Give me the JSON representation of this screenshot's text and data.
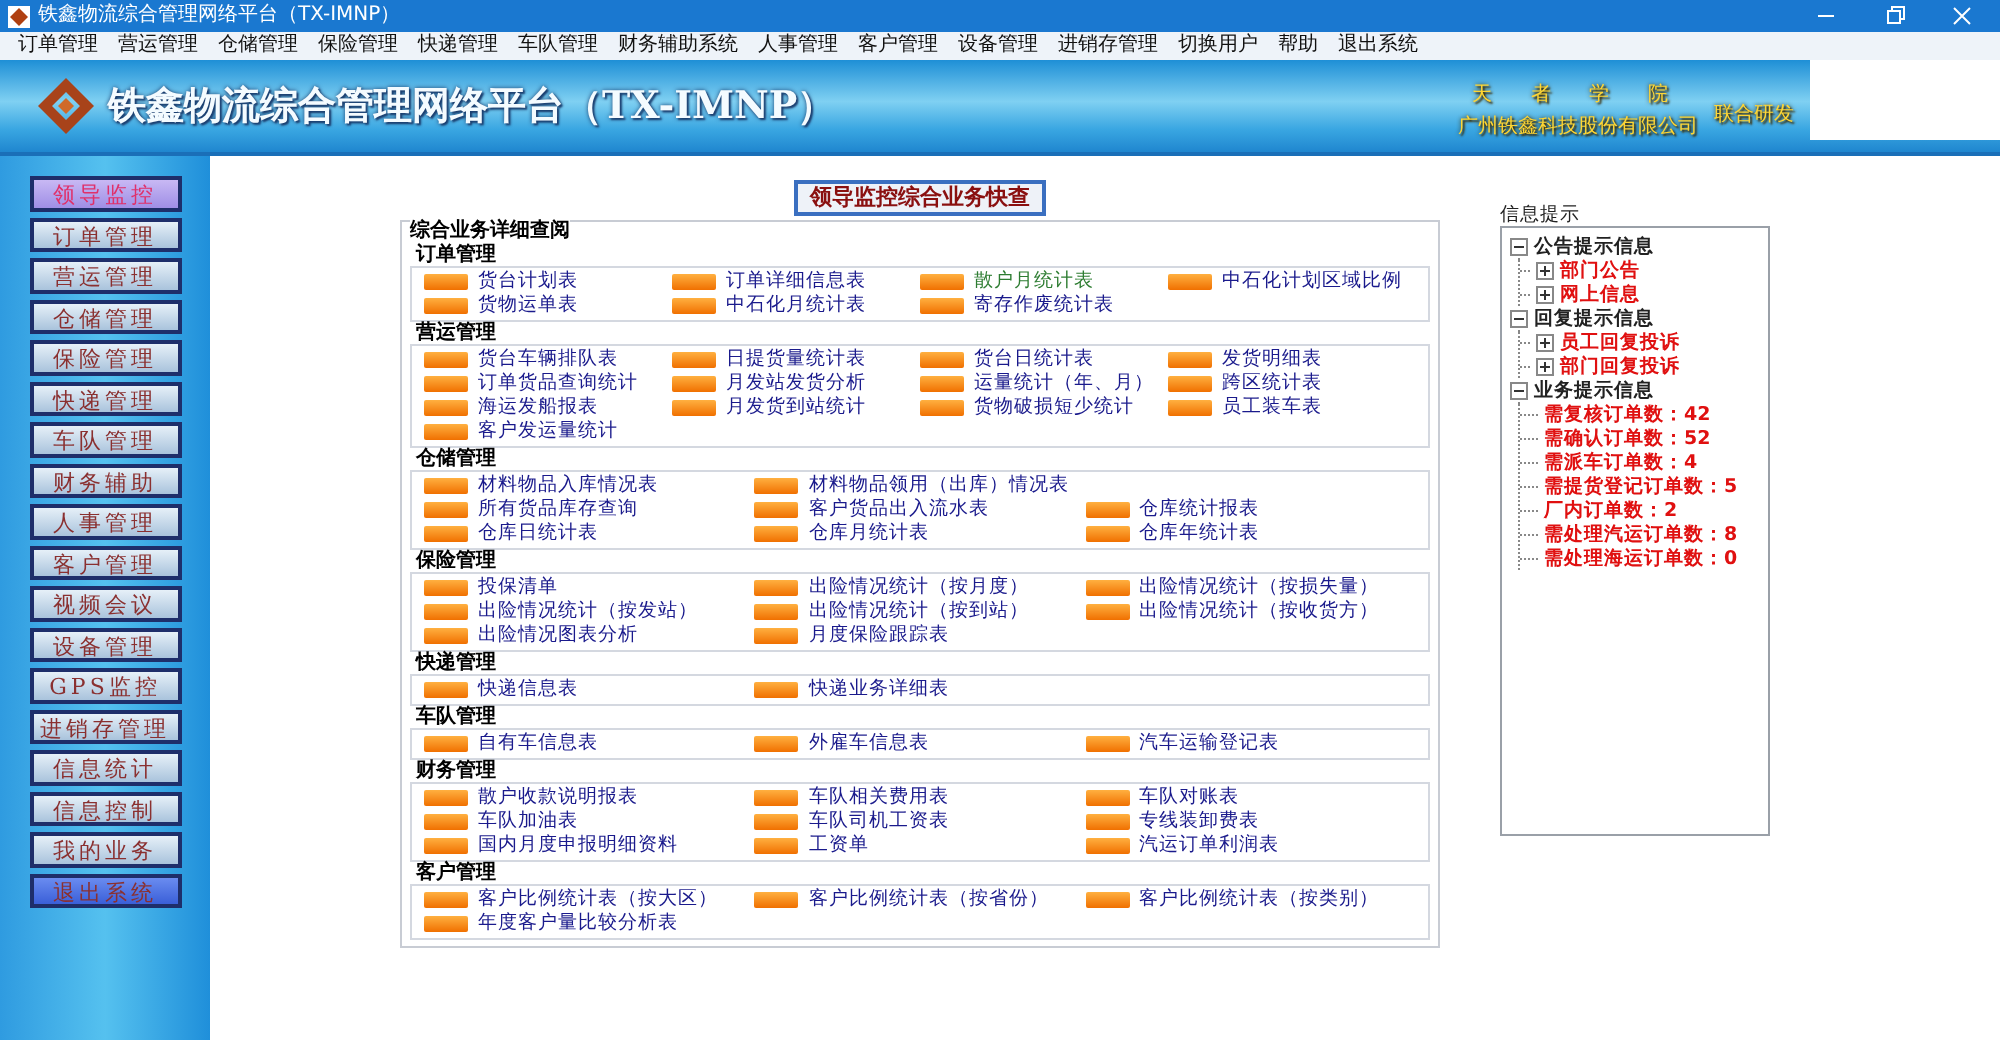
{
  "window": {
    "title": "铁鑫物流综合管理网络平台（TX-IMNP）"
  },
  "menu": [
    "订单管理",
    "营运管理",
    "仓储管理",
    "保险管理",
    "快递管理",
    "车队管理",
    "财务辅助系统",
    "人事管理",
    "客户管理",
    "设备管理",
    "进销存管理",
    "切换用户",
    "帮助",
    "退出系统"
  ],
  "banner": {
    "title": "铁鑫物流综合管理网络平台（TX-IMNP）",
    "motto": "天 者 学 院",
    "company": "广州铁鑫科技股份有限公司",
    "tag": "联合研发"
  },
  "sidebar": {
    "items": [
      {
        "label": "领导监控",
        "selected": true,
        "kind": "module"
      },
      {
        "label": "订单管理",
        "selected": false,
        "kind": "module"
      },
      {
        "label": "营运管理",
        "selected": false,
        "kind": "module"
      },
      {
        "label": "仓储管理",
        "selected": false,
        "kind": "module"
      },
      {
        "label": "保险管理",
        "selected": false,
        "kind": "module"
      },
      {
        "label": "快递管理",
        "selected": false,
        "kind": "module"
      },
      {
        "label": "车队管理",
        "selected": false,
        "kind": "module"
      },
      {
        "label": "财务辅助",
        "selected": false,
        "kind": "module"
      },
      {
        "label": "人事管理",
        "selected": false,
        "kind": "module"
      },
      {
        "label": "客户管理",
        "selected": false,
        "kind": "module"
      },
      {
        "label": "视频会议",
        "selected": false,
        "kind": "module"
      },
      {
        "label": "设备管理",
        "selected": false,
        "kind": "module"
      },
      {
        "label": "GPS监控",
        "selected": false,
        "kind": "module"
      },
      {
        "label": "进销存管理",
        "selected": false,
        "kind": "module"
      },
      {
        "label": "信息统计",
        "selected": false,
        "kind": "module"
      },
      {
        "label": "信息控制",
        "selected": false,
        "kind": "module"
      },
      {
        "label": "我的业务",
        "selected": false,
        "kind": "module"
      },
      {
        "label": "退出系统",
        "selected": false,
        "kind": "exit"
      }
    ]
  },
  "main": {
    "heading": "领导监控综合业务快查",
    "panel_title": "综合业务详细查阅",
    "sections": [
      {
        "title": "订单管理",
        "rows": [
          [
            {
              "label": "货台计划表"
            },
            {
              "label": "订单详细信息表"
            },
            {
              "label": "散户月统计表",
              "color": "#2e7d32"
            },
            {
              "label": "中石化计划区域比例"
            }
          ],
          [
            {
              "label": "货物运单表"
            },
            {
              "label": "中石化月统计表"
            },
            {
              "label": "寄存作废统计表"
            }
          ]
        ]
      },
      {
        "title": "营运管理",
        "rows": [
          [
            {
              "label": "货台车辆排队表"
            },
            {
              "label": "日提货量统计表"
            },
            {
              "label": "货台日统计表"
            },
            {
              "label": "发货明细表"
            }
          ],
          [
            {
              "label": "订单货品查询统计"
            },
            {
              "label": "月发站发货分析"
            },
            {
              "label": "运量统计（年、月）"
            },
            {
              "label": "跨区统计表"
            }
          ],
          [
            {
              "label": "海运发船报表"
            },
            {
              "label": "月发货到站统计"
            },
            {
              "label": "货物破损短少统计"
            },
            {
              "label": "员工装车表"
            }
          ],
          [
            {
              "label": "客户发运量统计"
            }
          ]
        ]
      },
      {
        "title": "仓储管理",
        "rows": [
          [
            {
              "label": "材料物品入库情况表"
            },
            {
              "label": "材料物品领用（出库）情况表"
            }
          ],
          [
            {
              "label": "所有货品库存查询"
            },
            {
              "label": "客户货品出入流水表"
            },
            {
              "label": "仓库统计报表"
            }
          ],
          [
            {
              "label": "仓库日统计表"
            },
            {
              "label": "仓库月统计表"
            },
            {
              "label": "仓库年统计表"
            }
          ]
        ]
      },
      {
        "title": "保险管理",
        "rows": [
          [
            {
              "label": "投保清单"
            },
            {
              "label": "出险情况统计（按月度）"
            },
            {
              "label": "出险情况统计（按损失量）"
            }
          ],
          [
            {
              "label": "出险情况统计（按发站）"
            },
            {
              "label": "出险情况统计（按到站）"
            },
            {
              "label": "出险情况统计（按收货方）"
            }
          ],
          [
            {
              "label": "出险情况图表分析"
            },
            {
              "label": "月度保险跟踪表"
            }
          ]
        ]
      },
      {
        "title": "快递管理",
        "rows": [
          [
            {
              "label": "快递信息表"
            },
            {
              "label": "快递业务详细表"
            }
          ]
        ]
      },
      {
        "title": "车队管理",
        "rows": [
          [
            {
              "label": "自有车信息表"
            },
            {
              "label": "外雇车信息表"
            },
            {
              "label": "汽车运输登记表"
            }
          ]
        ]
      },
      {
        "title": "财务管理",
        "rows": [
          [
            {
              "label": "散户收款说明报表"
            },
            {
              "label": "车队相关费用表"
            },
            {
              "label": "车队对账表"
            }
          ],
          [
            {
              "label": "车队加油表"
            },
            {
              "label": "车队司机工资表"
            },
            {
              "label": "专线装卸费表"
            }
          ],
          [
            {
              "label": "国内月度申报明细资料"
            },
            {
              "label": "工资单"
            },
            {
              "label": "汽运订单利润表"
            }
          ]
        ]
      },
      {
        "title": "客户管理",
        "rows": [
          [
            {
              "label": "客户比例统计表（按大区）"
            },
            {
              "label": "客户比例统计表（按省份）"
            },
            {
              "label": "客户比例统计表（按类别）"
            }
          ],
          [
            {
              "label": "年度客户量比较分析表"
            }
          ]
        ]
      }
    ]
  },
  "info": {
    "title": "信息提示",
    "groups": [
      {
        "label": "公告提示信息",
        "expanded": true,
        "children": [
          {
            "label": "部门公告",
            "kind": "node",
            "expanded": false
          },
          {
            "label": "网上信息",
            "kind": "node",
            "expanded": false
          }
        ]
      },
      {
        "label": "回复提示信息",
        "expanded": true,
        "children": [
          {
            "label": "员工回复投诉",
            "kind": "node",
            "expanded": false
          },
          {
            "label": "部门回复投诉",
            "kind": "node",
            "expanded": false
          }
        ]
      },
      {
        "label": "业务提示信息",
        "expanded": true,
        "children": [
          {
            "label": "需复核订单数：42",
            "kind": "leaf"
          },
          {
            "label": "需确认订单数：52",
            "kind": "leaf"
          },
          {
            "label": "需派车订单数：4",
            "kind": "leaf"
          },
          {
            "label": "需提货登记订单数：5",
            "kind": "leaf"
          },
          {
            "label": "厂内订单数：2",
            "kind": "leaf"
          },
          {
            "label": "需处理汽运订单数：8",
            "kind": "leaf"
          },
          {
            "label": "需处理海运订单数：0",
            "kind": "leaf"
          }
        ]
      }
    ]
  }
}
